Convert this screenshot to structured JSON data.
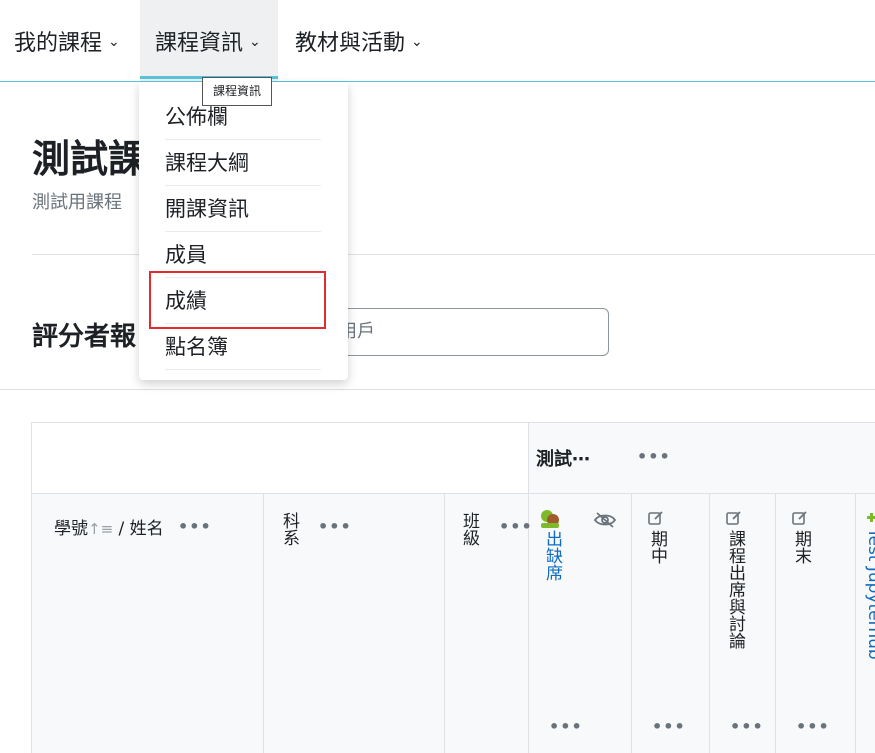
{
  "nav": {
    "my_courses": "我的課程",
    "course_info": "課程資訊",
    "materials": "教材與活動",
    "chevron": "⌄"
  },
  "tooltip": "課程資訊",
  "dropdown": {
    "items": [
      "公佈欄",
      "課程大綱",
      "開課資訊",
      "成員",
      "成績",
      "點名簿"
    ],
    "highlighted": "成績"
  },
  "page": {
    "title": "測試課",
    "subtitle": "測試用課程"
  },
  "grader": {
    "title": "評分者報",
    "search_visible": "用戶"
  },
  "table": {
    "category": "測試⋯",
    "more": "•••",
    "columns": {
      "name": {
        "label": "學號",
        "sep": " / 姓名"
      },
      "dept": "科系",
      "class": "班級",
      "attendance": "出缺席",
      "midterm": "期中",
      "discussion": "課程出席與討論",
      "final": "期末",
      "test": "Test Jupyterhub"
    }
  },
  "colors": {
    "accent": "#5bc3d9",
    "link": "#0f6cbf",
    "highlight_border": "#e02b33",
    "attendance_icon": "#7dba2a"
  }
}
